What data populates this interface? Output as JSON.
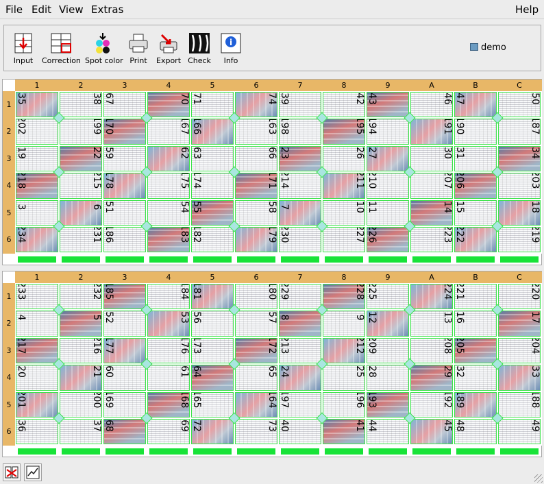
{
  "menu": {
    "file": "File",
    "edit": "Edit",
    "view": "View",
    "extras": "Extras",
    "help": "Help"
  },
  "toolbar": {
    "input": "Input",
    "correction": "Correction",
    "spot_color": "Spot color",
    "print": "Print",
    "export": "Export",
    "check": "Check",
    "info": "Info",
    "job": "demo"
  },
  "columns": [
    "1",
    "2",
    "3",
    "4",
    "5",
    "6",
    "7",
    "8",
    "9",
    "A",
    "B",
    "C"
  ],
  "rows": [
    "1",
    "2",
    "3",
    "4",
    "5",
    "6"
  ],
  "sheet1": {
    "pages": [
      [
        "35",
        "38",
        "67",
        "70",
        "71",
        "74",
        "39",
        "42",
        "43",
        "46",
        "47",
        "50"
      ],
      [
        "202",
        "199",
        "170",
        "167",
        "166",
        "163",
        "198",
        "195",
        "194",
        "191",
        "190",
        "187"
      ],
      [
        "19",
        "22",
        "59",
        "62",
        "63",
        "66",
        "23",
        "26",
        "27",
        "30",
        "31",
        "34"
      ],
      [
        "218",
        "215",
        "178",
        "175",
        "174",
        "171",
        "214",
        "211",
        "210",
        "207",
        "206",
        "203"
      ],
      [
        "3",
        "6",
        "51",
        "54",
        "55",
        "58",
        "7",
        "10",
        "11",
        "14",
        "15",
        "18"
      ],
      [
        "234",
        "231",
        "186",
        "183",
        "182",
        "179",
        "230",
        "227",
        "226",
        "223",
        "222",
        "219"
      ]
    ]
  },
  "sheet2": {
    "pages": [
      [
        "233",
        "232",
        "185",
        "184",
        "181",
        "180",
        "229",
        "228",
        "225",
        "224",
        "221",
        "220"
      ],
      [
        "4",
        "5",
        "52",
        "53",
        "56",
        "57",
        "8",
        "9",
        "12",
        "13",
        "16",
        "17"
      ],
      [
        "217",
        "216",
        "177",
        "176",
        "173",
        "172",
        "213",
        "212",
        "209",
        "208",
        "205",
        "204"
      ],
      [
        "20",
        "21",
        "60",
        "61",
        "64",
        "65",
        "24",
        "25",
        "28",
        "29",
        "32",
        "33"
      ],
      [
        "201",
        "200",
        "169",
        "168",
        "165",
        "164",
        "197",
        "196",
        "193",
        "192",
        "189",
        "188"
      ],
      [
        "36",
        "37",
        "68",
        "69",
        "72",
        "73",
        "40",
        "41",
        "44",
        "45",
        "48",
        "49"
      ]
    ]
  },
  "colors": {
    "header": "#e8b767",
    "grid": "#3de34b",
    "bar": "#18e338"
  },
  "icons": [
    "input-icon",
    "correction-icon",
    "spot-color-icon",
    "print-icon",
    "export-icon",
    "check-icon",
    "info-icon",
    "monitor-icon",
    "layout-icon",
    "chart-icon",
    "resize-grip-icon"
  ]
}
